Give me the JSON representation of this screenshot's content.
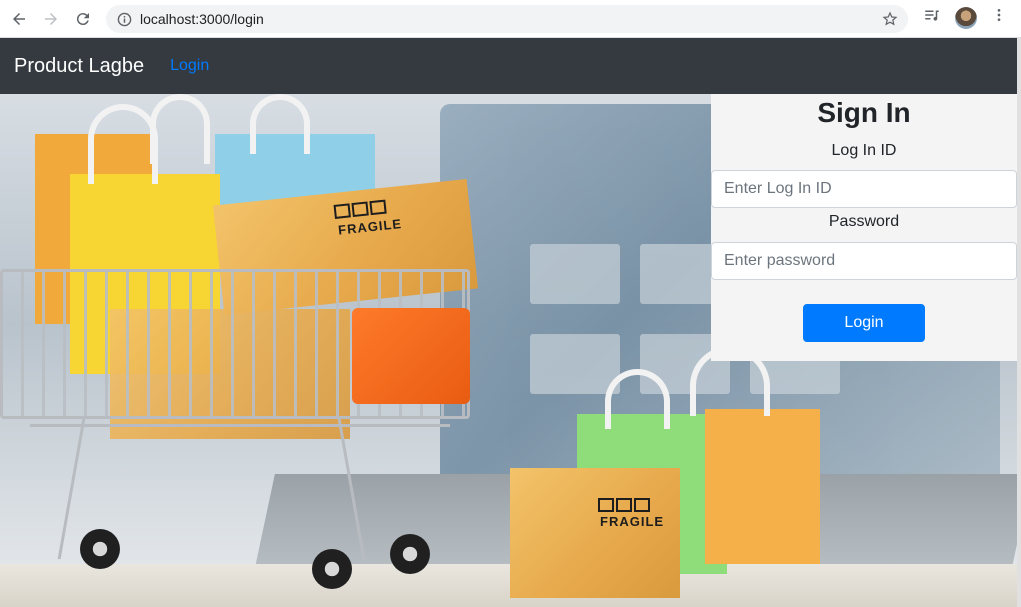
{
  "browser": {
    "url": "localhost:3000/login",
    "icons": [
      "back-arrow-icon",
      "forward-arrow-icon",
      "reload-icon",
      "site-info-icon",
      "bookmark-star-icon",
      "media-queue-icon",
      "profile-avatar",
      "more-menu-icon"
    ]
  },
  "navbar": {
    "brand": "Product Lagbe",
    "link": "Login"
  },
  "hero": {
    "fragile_text": "FRAGILE"
  },
  "signin": {
    "title": "Sign In",
    "id_label": "Log In ID",
    "id_placeholder": "Enter Log In ID",
    "id_value": "",
    "password_label": "Password",
    "password_placeholder": "Enter password",
    "password_value": "",
    "submit_label": "Login"
  },
  "colors": {
    "navbar_bg": "#343a40",
    "link": "#007bff",
    "button": "#007bff",
    "panel_bg": "#f4f4f4"
  }
}
